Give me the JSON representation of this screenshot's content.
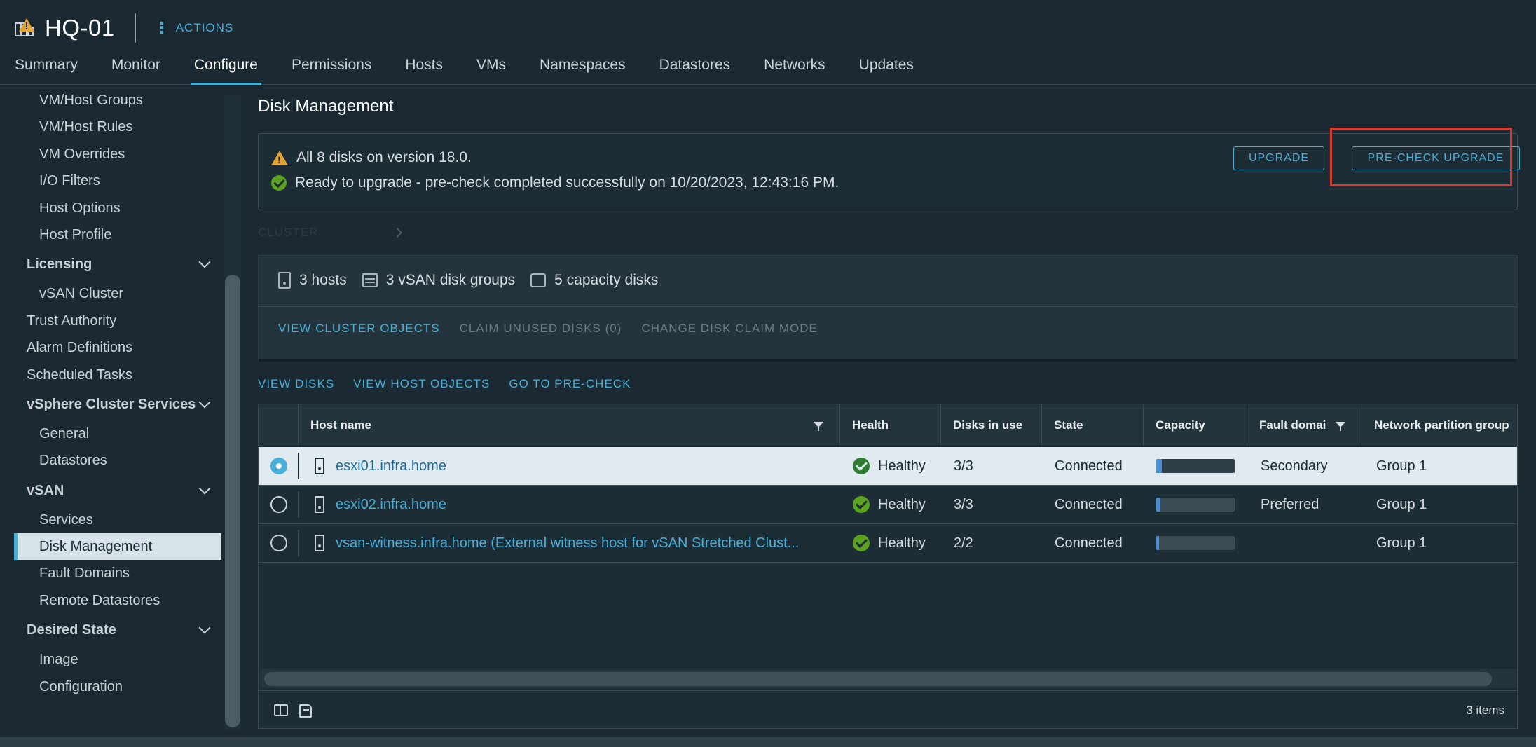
{
  "header": {
    "title": "HQ-01",
    "actions_label": "ACTIONS",
    "tabs": [
      "Summary",
      "Monitor",
      "Configure",
      "Permissions",
      "Hosts",
      "VMs",
      "Namespaces",
      "Datastores",
      "Networks",
      "Updates"
    ],
    "active_tab": "Configure"
  },
  "sidebar": {
    "items": [
      {
        "label": "VM/Host Groups",
        "type": "sub"
      },
      {
        "label": "VM/Host Rules",
        "type": "sub"
      },
      {
        "label": "VM Overrides",
        "type": "sub"
      },
      {
        "label": "I/O Filters",
        "type": "sub"
      },
      {
        "label": "Host Options",
        "type": "sub"
      },
      {
        "label": "Host Profile",
        "type": "sub"
      },
      {
        "label": "Licensing",
        "type": "group"
      },
      {
        "label": "vSAN Cluster",
        "type": "sub"
      },
      {
        "label": "Trust Authority",
        "type": "top"
      },
      {
        "label": "Alarm Definitions",
        "type": "top"
      },
      {
        "label": "Scheduled Tasks",
        "type": "top"
      },
      {
        "label": "vSphere Cluster Services",
        "type": "group"
      },
      {
        "label": "General",
        "type": "sub"
      },
      {
        "label": "Datastores",
        "type": "sub"
      },
      {
        "label": "vSAN",
        "type": "group"
      },
      {
        "label": "Services",
        "type": "sub"
      },
      {
        "label": "Disk Management",
        "type": "sub",
        "active": true
      },
      {
        "label": "Fault Domains",
        "type": "sub"
      },
      {
        "label": "Remote Datastores",
        "type": "sub"
      },
      {
        "label": "Desired State",
        "type": "group"
      },
      {
        "label": "Image",
        "type": "sub"
      },
      {
        "label": "Configuration",
        "type": "sub"
      }
    ]
  },
  "main": {
    "page_title": "Disk Management",
    "banner": {
      "warning_text": "All 8 disks on version 18.0.",
      "success_text": "Ready to upgrade - pre-check completed successfully on 10/20/2023, 12:43:16 PM.",
      "upgrade_label": "UPGRADE",
      "precheck_label": "PRE-CHECK UPGRADE"
    },
    "faded_crumb": "CLUSTER",
    "summary": {
      "hosts": "3 hosts",
      "disk_groups": "3 vSAN disk groups",
      "capacity_disks": "5 capacity disks",
      "links": {
        "view_cluster_objects": "VIEW CLUSTER OBJECTS",
        "claim_unused": "CLAIM UNUSED DISKS (0)",
        "change_claim_mode": "CHANGE DISK CLAIM MODE"
      }
    },
    "view_links": {
      "view_disks": "VIEW DISKS",
      "view_host_objects": "VIEW HOST OBJECTS",
      "go_to_precheck": "GO TO PRE-CHECK"
    },
    "table": {
      "columns": {
        "host_name": "Host name",
        "health": "Health",
        "disks_in_use": "Disks in use",
        "state": "State",
        "capacity": "Capacity",
        "fault_domain": "Fault domai",
        "network_partition": "Network partition group"
      },
      "rows": [
        {
          "host": "esxi01.infra.home",
          "health": "Healthy",
          "disks": "3/3",
          "state": "Connected",
          "capacity_used": 0.07,
          "fault": "Secondary",
          "net": "Group 1",
          "selected": true
        },
        {
          "host": "esxi02.infra.home",
          "health": "Healthy",
          "disks": "3/3",
          "state": "Connected",
          "capacity_used": 0.05,
          "fault": "Preferred",
          "net": "Group 1",
          "selected": false
        },
        {
          "host": "vsan-witness.infra.home (External witness host for vSAN Stretched Clust...",
          "health": "Healthy",
          "disks": "2/2",
          "state": "Connected",
          "capacity_used": 0.04,
          "fault": "",
          "net": "Group 1",
          "selected": false
        }
      ],
      "item_count": "3 items"
    }
  },
  "colors": {
    "accent": "#49afd9",
    "background": "#1b2a32",
    "success": "#5aa220",
    "warning": "#e4a436",
    "highlight": "#d93a2b"
  }
}
